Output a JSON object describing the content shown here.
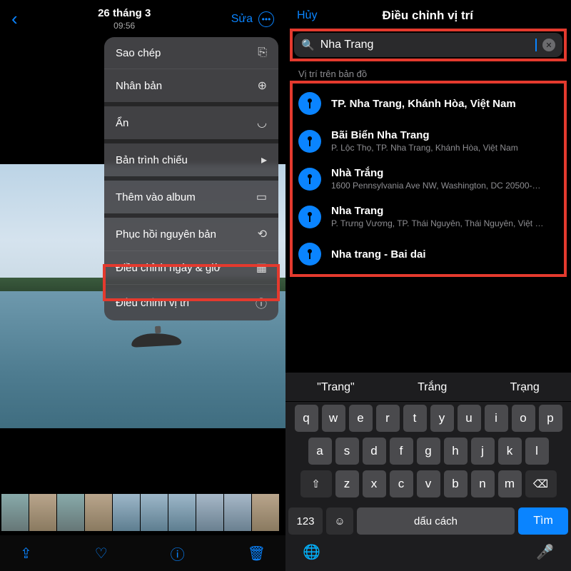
{
  "left": {
    "header": {
      "date": "26 tháng 3",
      "time": "09:56",
      "edit": "Sửa"
    },
    "menu": {
      "items": [
        {
          "label": "Sao chép",
          "icon": "⎘"
        },
        {
          "label": "Nhân bản",
          "icon": "⊕"
        },
        {
          "label": "Ẩn",
          "icon": "◡"
        },
        {
          "label": "Bản trình chiếu",
          "icon": "▸"
        },
        {
          "label": "Thêm vào album",
          "icon": "▭"
        },
        {
          "label": "Phục hồi nguyên bản",
          "icon": "⟲"
        },
        {
          "label": "Điều chỉnh ngày & giờ",
          "icon": "▦"
        },
        {
          "label": "Điều chỉnh vị trí",
          "icon": "ⓘ"
        }
      ]
    }
  },
  "right": {
    "header": {
      "cancel": "Hủy",
      "title": "Điều chỉnh vị trí"
    },
    "search": {
      "query": "Nha Trang"
    },
    "sectionHeader": "Vị trí trên bản đồ",
    "results": [
      {
        "title": "TP. Nha Trang, Khánh Hòa, Việt Nam",
        "subtitle": ""
      },
      {
        "title": "Bãi Biển Nha Trang",
        "subtitle": "P. Lộc Thọ, TP. Nha Trang, Khánh Hòa, Việt Nam"
      },
      {
        "title": "Nhà Trắng",
        "subtitle": "1600 Pennsylvania Ave NW, Washington, DC 20500-0…"
      },
      {
        "title": "Nha Trang",
        "subtitle": "P. Trưng Vương, TP. Thái Nguyên, Thái Nguyên, Việt N…"
      },
      {
        "title": "Nha trang - Bai dai",
        "subtitle": ""
      }
    ],
    "keyboard": {
      "suggestions": [
        "\"Trang\"",
        "Trắng",
        "Trạng"
      ],
      "row1": [
        "q",
        "w",
        "e",
        "r",
        "t",
        "y",
        "u",
        "i",
        "o",
        "p"
      ],
      "row2": [
        "a",
        "s",
        "d",
        "f",
        "g",
        "h",
        "j",
        "k",
        "l"
      ],
      "row3": [
        "z",
        "x",
        "c",
        "v",
        "b",
        "n",
        "m"
      ],
      "shift": "⇧",
      "backspace": "⌫",
      "numKey": "123",
      "emoji": "☺",
      "space": "dấu cách",
      "search": "Tìm",
      "globe": "🌐",
      "mic": "🎤"
    }
  }
}
